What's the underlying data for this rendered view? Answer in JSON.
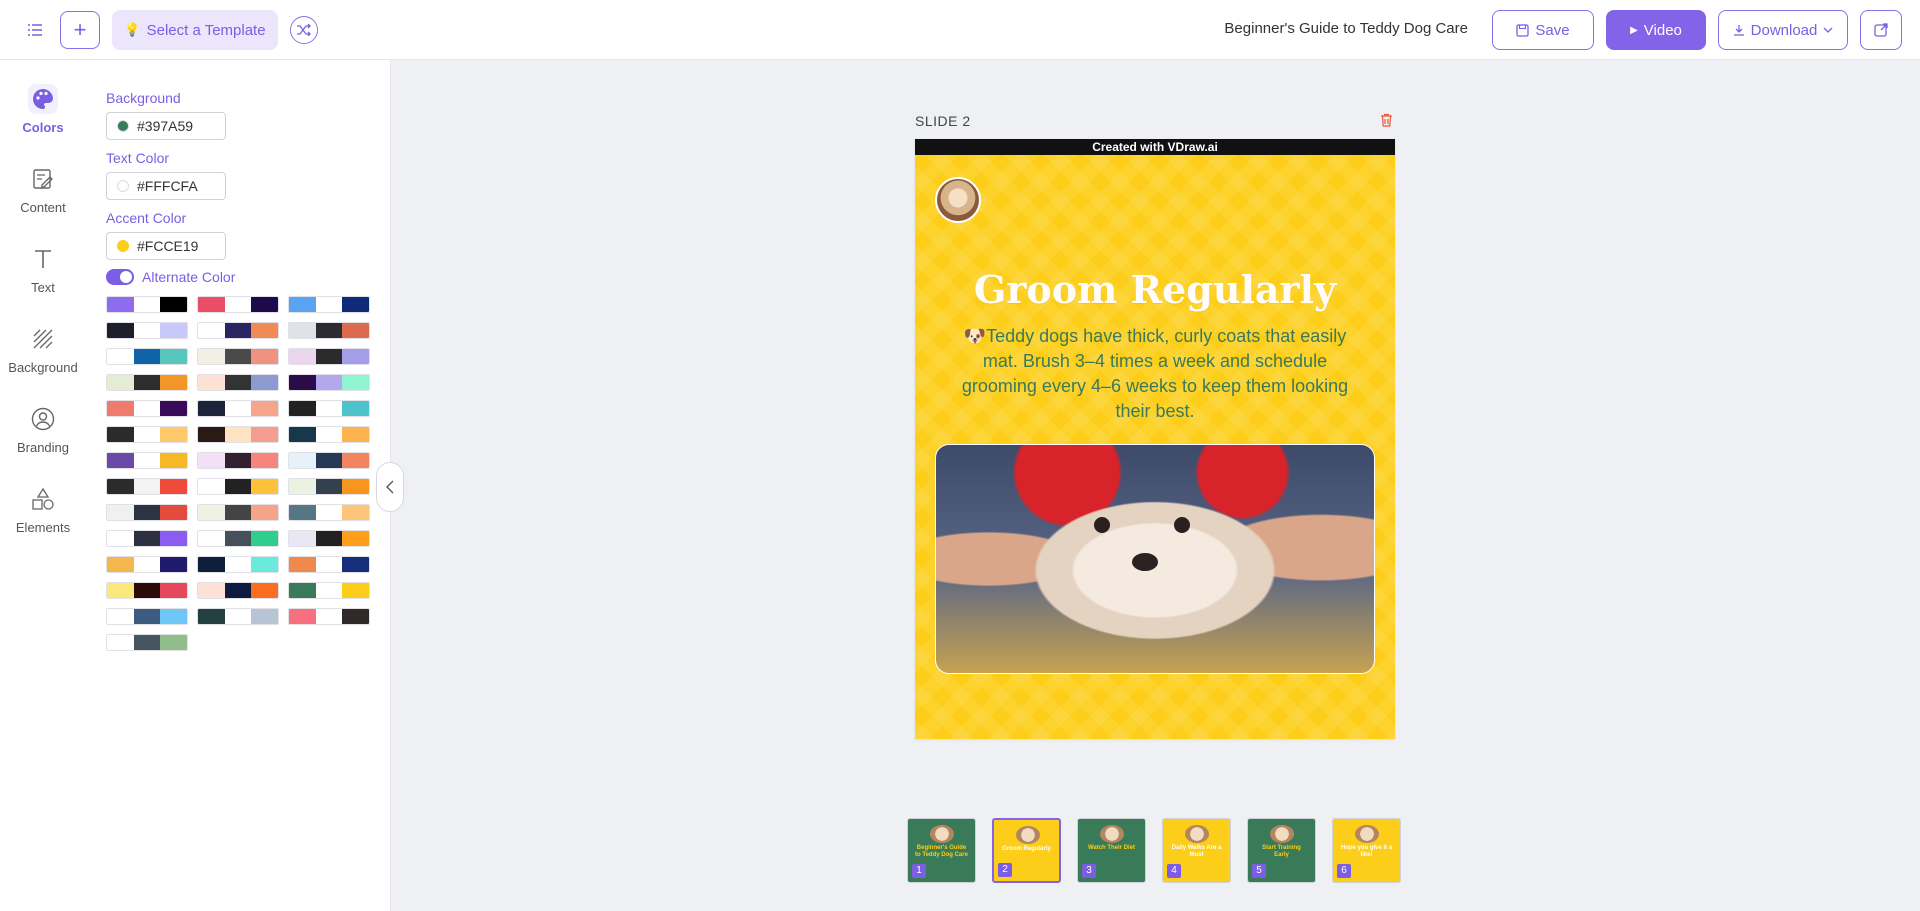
{
  "header": {
    "template_label": "Select a Template",
    "doc_title": "Beginner's Guide to Teddy Dog Care",
    "save_label": "Save",
    "video_label": "Video",
    "download_label": "Download"
  },
  "rail": {
    "items": [
      {
        "label": "Colors",
        "icon": "palette-icon"
      },
      {
        "label": "Content",
        "icon": "edit-document-icon"
      },
      {
        "label": "Text",
        "icon": "text-icon"
      },
      {
        "label": "Background",
        "icon": "hatch-pattern-icon"
      },
      {
        "label": "Branding",
        "icon": "user-circle-icon"
      },
      {
        "label": "Elements",
        "icon": "shapes-icon"
      }
    ]
  },
  "colors_panel": {
    "background_label": "Background",
    "background_value": "#397A59",
    "text_color_label": "Text Color",
    "text_color_value": "#FFFCFA",
    "accent_label": "Accent Color",
    "accent_value": "#FCCE19",
    "alternate_label": "Alternate Color",
    "alternate_on": true,
    "palettes": [
      [
        "#8e6cf0",
        "#ffffff",
        "#000000"
      ],
      [
        "#e94e66",
        "#ffffff",
        "#1e0a4a"
      ],
      [
        "#5aa3f0",
        "#ffffff",
        "#0e2a78"
      ],
      [
        "#1d1f2b",
        "#ffffff",
        "#c8c8fb"
      ],
      [
        "#ffffff",
        "#2a2560",
        "#f08b55"
      ],
      [
        "#dfe3e7",
        "#2b2b33",
        "#db6a4e"
      ],
      [
        "#ffffff",
        "#0f63a6",
        "#57c7bd"
      ],
      [
        "#f2f0e4",
        "#4a4a4a",
        "#ef9380"
      ],
      [
        "#ecd6ef",
        "#2a2a2a",
        "#a49ee8"
      ],
      [
        "#e4ecd3",
        "#2d2d2d",
        "#f39628"
      ],
      [
        "#fde2d4",
        "#333333",
        "#8c9ad0"
      ],
      [
        "#2c0c48",
        "#b4a7ee",
        "#8ef5cf"
      ],
      [
        "#ee7b6b",
        "#ffffff",
        "#3a0a5a"
      ],
      [
        "#1d2338",
        "#ffffff",
        "#f5a58a"
      ],
      [
        "#222222",
        "#ffffff",
        "#4fc3cb"
      ],
      [
        "#2b2b2b",
        "#ffffff",
        "#fdc96a"
      ],
      [
        "#2a1a14",
        "#fde3bf",
        "#f39e8e"
      ],
      [
        "#15394b",
        "#ffffff",
        "#fdb44f"
      ],
      [
        "#6a4aa6",
        "#ffffff",
        "#f7b826"
      ],
      [
        "#f2e0f4",
        "#33202f",
        "#f5857d"
      ],
      [
        "#e5f2fa",
        "#253856",
        "#f2845f"
      ],
      [
        "#2b2b2b",
        "#f3f3f3",
        "#ee4b3a"
      ],
      [
        "#ffffff",
        "#222222",
        "#fdc23a"
      ],
      [
        "#eaf2e1",
        "#33404d",
        "#f8951f"
      ],
      [
        "#f0f0f0",
        "#2c3444",
        "#e34b3c"
      ],
      [
        "#eef2e2",
        "#444444",
        "#f5a488"
      ],
      [
        "#567685",
        "#ffffff",
        "#fcc57a"
      ],
      [
        "#ffffff",
        "#2c3040",
        "#8a5cf0"
      ],
      [
        "#ffffff",
        "#45505b",
        "#2fce8f"
      ],
      [
        "#ebe6f4",
        "#222222",
        "#fd9f1a"
      ],
      [
        "#f2b84b",
        "#ffffff",
        "#1f1a6e"
      ],
      [
        "#0f1f3a",
        "#ffffff",
        "#6aeadc"
      ],
      [
        "#ef8a4c",
        "#ffffff",
        "#152f7a"
      ],
      [
        "#fbe87d",
        "#2b0a0a",
        "#e5485d"
      ],
      [
        "#fde0d6",
        "#0e1a40",
        "#fa6e21"
      ],
      [
        "#397A59",
        "#ffffff",
        "#FCCE19"
      ],
      [
        "#ffffff",
        "#3b5b80",
        "#6ec6f6"
      ],
      [
        "#254040",
        "#ffffff",
        "#b7c4d4"
      ],
      [
        "#f7707f",
        "#ffffff",
        "#2f2a28"
      ],
      [
        "#ffffff",
        "#445560",
        "#8fbe8a"
      ]
    ]
  },
  "slide": {
    "label": "SLIDE 2",
    "banner": "Created with VDraw.ai",
    "title": "Groom Regularly",
    "body": "🐶Teddy dogs have thick, curly coats that easily mat. Brush 3–4 times a week and schedule grooming every 4–6 weeks to keep them looking their best."
  },
  "thumbnails": [
    {
      "num": "1",
      "bg": "#397A59",
      "title": "Beginner's Guide to Teddy Dog Care"
    },
    {
      "num": "2",
      "bg": "#FCCE19",
      "title": "Groom Regularly"
    },
    {
      "num": "3",
      "bg": "#397A59",
      "title": "Watch Their Diet"
    },
    {
      "num": "4",
      "bg": "#FCCE19",
      "title": "Daily Walks Are a Must"
    },
    {
      "num": "5",
      "bg": "#397A59",
      "title": "Start Training Early"
    },
    {
      "num": "6",
      "bg": "#FCCE19",
      "title": "Hope you give it a like!"
    }
  ]
}
